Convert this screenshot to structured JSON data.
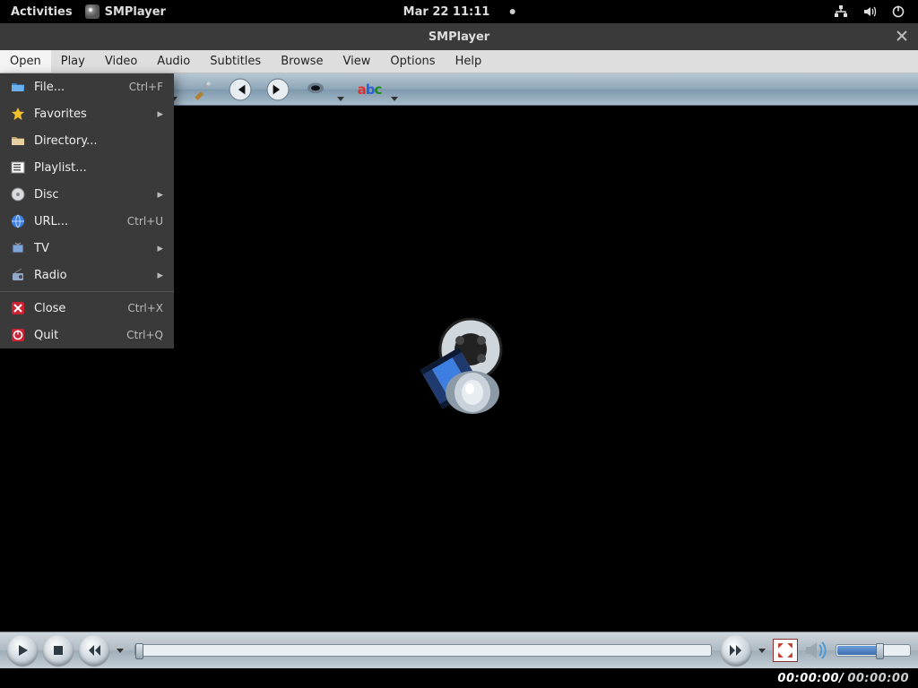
{
  "topbar": {
    "activities": "Activities",
    "app": "SMPlayer",
    "clock": "Mar 22  11:11"
  },
  "window": {
    "title": "SMPlayer"
  },
  "menubar": [
    "Open",
    "Play",
    "Video",
    "Audio",
    "Subtitles",
    "Browse",
    "View",
    "Options",
    "Help"
  ],
  "open_menu": [
    {
      "icon": "folder-blue",
      "label": "File...",
      "shortcut": "Ctrl+F"
    },
    {
      "icon": "star",
      "label": "Favorites",
      "submenu": true
    },
    {
      "icon": "folder",
      "label": "Directory..."
    },
    {
      "icon": "playlist",
      "label": "Playlist..."
    },
    {
      "icon": "disc",
      "label": "Disc",
      "submenu": true
    },
    {
      "icon": "globe",
      "label": "URL...",
      "shortcut": "Ctrl+U"
    },
    {
      "icon": "tv",
      "label": "TV",
      "submenu": true
    },
    {
      "icon": "radio",
      "label": "Radio",
      "submenu": true
    },
    {
      "sep": true
    },
    {
      "icon": "close-x",
      "label": "Close",
      "shortcut": "Ctrl+X"
    },
    {
      "icon": "power",
      "label": "Quit",
      "shortcut": "Ctrl+Q"
    }
  ],
  "toolbar_icons": [
    "open-file",
    "info",
    "playlist-doc",
    "clapper",
    "prefs",
    "skip-back",
    "skip-fwd",
    "eye",
    "subs-abc"
  ],
  "controls": {
    "play": "play",
    "stop": "stop",
    "rew": "rewind",
    "ffwd": "forward"
  },
  "time": {
    "pos": "00:00:00",
    "sep": " / ",
    "dur": "00:00:00"
  }
}
